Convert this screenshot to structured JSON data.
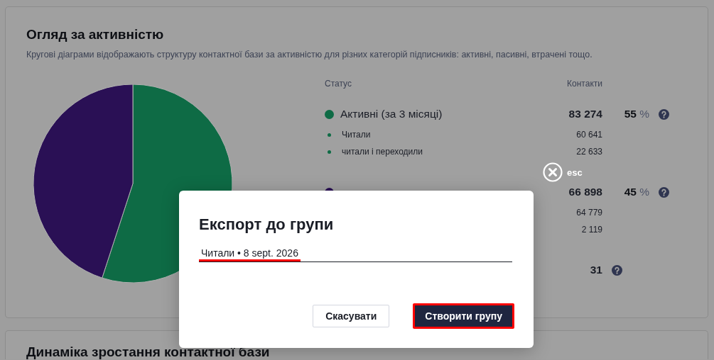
{
  "activity_card": {
    "title": "Огляд за активністю",
    "description": "Кругові діаграми відображають структуру контактної бази за активністю для різних категорій підписників: активні, пасивні, втрачені тощо.",
    "chart_data": {
      "type": "pie",
      "values": [
        55,
        45
      ]
    },
    "status_table": {
      "columns": [
        "Статус",
        "Контакти"
      ],
      "groups": [
        {
          "color": "#0e6b45",
          "label": "Активні (за 3 місяці)",
          "contacts": "83 274",
          "percent": "**55** %",
          "help": true,
          "subrows": [
            {
              "label": "Читали",
              "contacts": "60 641"
            },
            {
              "label": "читали і переходили",
              "contacts": "22 633"
            }
          ]
        },
        {
          "color": "#2a1055",
          "contacts": "66 898",
          "percent": "**45** %",
          "help": true,
          "subrows": [
            {
              "contacts": "64 779"
            },
            {
              "contacts": "2 119"
            }
          ]
        },
        {
          "contacts": "31",
          "help": true
        }
      ]
    }
  },
  "next_card": {
    "title": "Динаміка зростання контактної бази"
  },
  "close_hint": {
    "label": "esc"
  },
  "dialog": {
    "title": "Експорт до групи",
    "field_value": "Читали • 8 sept. 2026",
    "buttons": [
      {
        "label": "Скасувати",
        "kind": "secondary"
      },
      {
        "label": "Створити групу",
        "kind": "primary"
      }
    ]
  }
}
